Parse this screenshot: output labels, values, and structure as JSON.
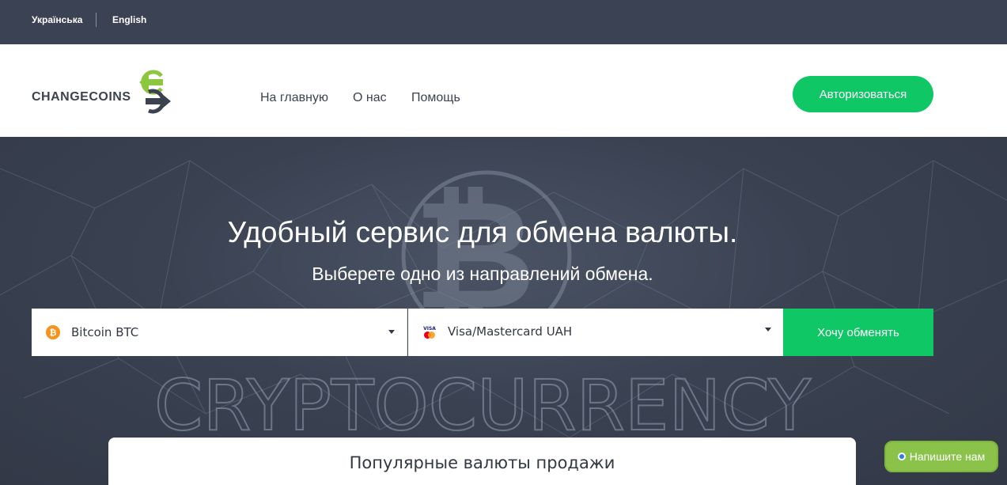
{
  "topbar": {
    "languages": [
      "Українська",
      "English"
    ]
  },
  "header": {
    "logo_text": "CHANGECOINS",
    "nav": [
      "На главную",
      "О нас",
      "Помощь"
    ],
    "login_label": "Авторизоваться"
  },
  "hero": {
    "title": "Удобный сервис для обмена валюты.",
    "subtitle": "Выберете одно из направлений обмена.",
    "watermark": "CRYPTOCURRENCY",
    "from_currency": "Bitcoin BTC",
    "to_currency": "Visa/Mastercard UAH",
    "submit_label": "Хочу обменять"
  },
  "popular": {
    "title": "Популярные валюты продажи"
  },
  "chat": {
    "label": "Напишите нам"
  },
  "colors": {
    "accent": "#10c766",
    "topbar": "#3b4253",
    "chat": "#8bc34a"
  },
  "icons": {
    "logo": "arrows-exchange-icon",
    "from": "bitcoin-icon",
    "to": "visa-mastercard-icon"
  }
}
